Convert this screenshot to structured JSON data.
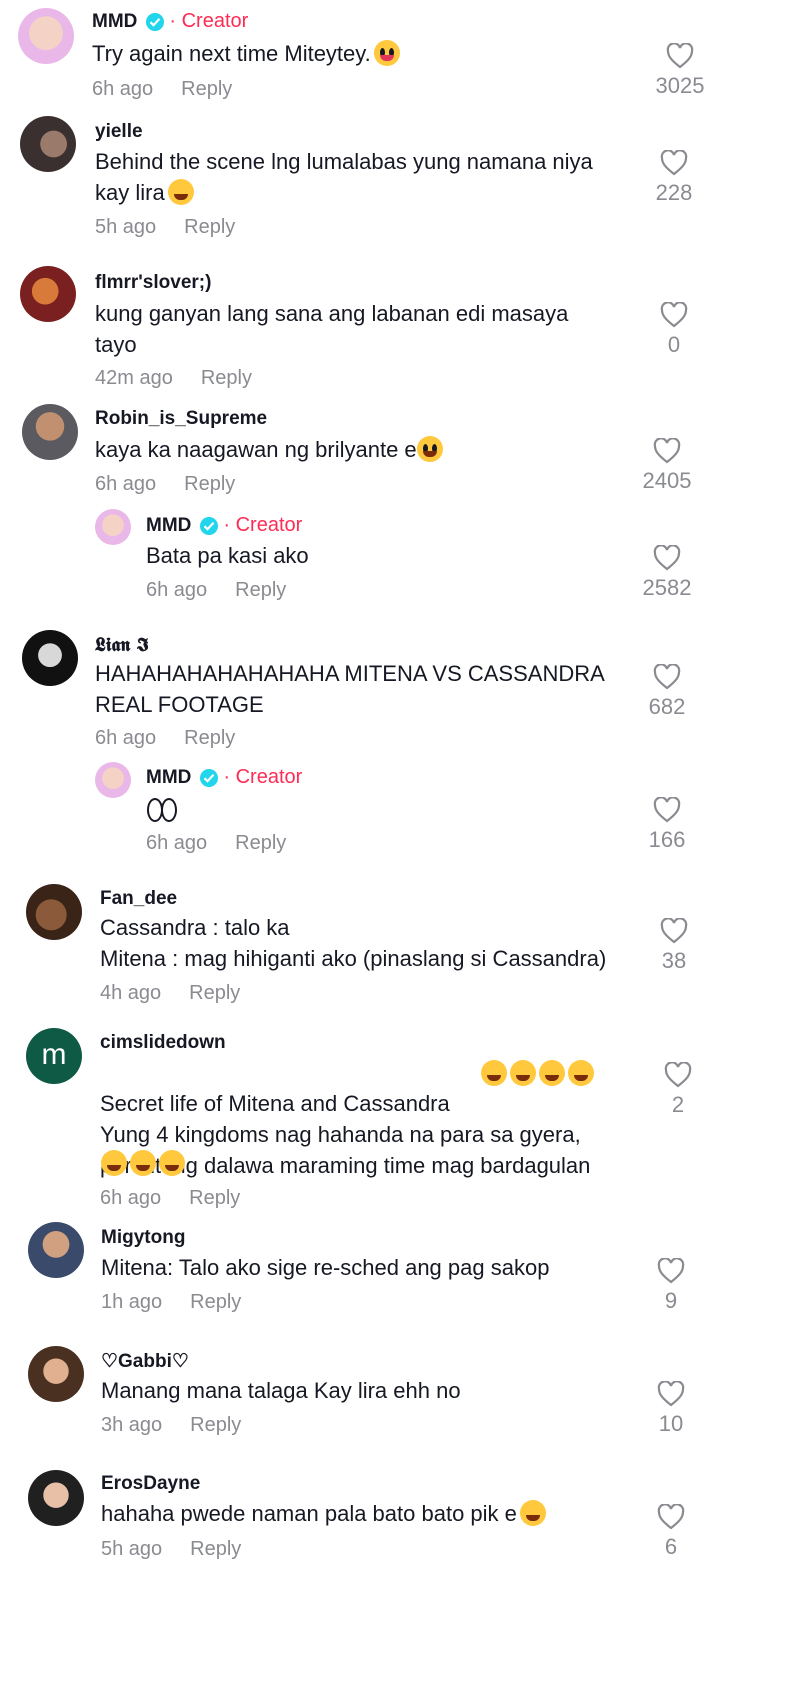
{
  "creator_label": "· Creator",
  "reply_label": "Reply",
  "comments": [
    {
      "user": "MMD",
      "creator": true,
      "text": "Try again next time Miteytey.",
      "time": "6h ago",
      "likes": "3025"
    },
    {
      "user": "yielle",
      "text": "Behind the scene lng lumalabas yung namana niya\nkay lira",
      "time": "5h ago",
      "likes": "228"
    },
    {
      "user": "flmrr'slover;)",
      "text": "kung ganyan lang sana ang labanan edi masaya\ntayo",
      "time": "42m ago",
      "likes": "0"
    },
    {
      "user": "Robin_is_Supreme",
      "text": "kaya ka naagawan ng brilyante e",
      "time": "6h ago",
      "likes": "2405"
    },
    {
      "user": "MMD",
      "creator": true,
      "reply": true,
      "text": "Bata pa kasi ako",
      "time": "6h ago",
      "likes": "2582"
    },
    {
      "user": "𝕷𝖎𝖆𝖓 𝕴",
      "text": "HAHAHAHAHAHAHAHA MITENA VS CASSANDRA\nREAL FOOTAGE",
      "time": "6h ago",
      "likes": "682"
    },
    {
      "user": "MMD",
      "creator": true,
      "reply": true,
      "text": "",
      "time": "6h ago",
      "likes": "166"
    },
    {
      "user": "Fan_dee",
      "text": "Cassandra : talo ka\nMitena : mag hihiganti ako (pinaslang si Cassandra)",
      "time": "4h ago",
      "likes": "38"
    },
    {
      "user": "cimslidedown",
      "text": "Secret life of Mitena and Cassandra\nYung 4 kingdoms nag hahanda na para sa gyera,\npero itong dalawa maraming time mag bardagulan",
      "time": "6h ago",
      "likes": "2",
      "avatar_letter": "m"
    },
    {
      "user": "Migytong",
      "text": "Mitena: Talo ako sige re-sched ang pag sakop",
      "time": "1h ago",
      "likes": "9"
    },
    {
      "user": "♡Gabbi♡",
      "text": "Manang mana talaga Kay lira ehh no",
      "time": "3h ago",
      "likes": "10"
    },
    {
      "user": "ErosDayne",
      "text": "hahaha pwede naman pala bato bato pik e",
      "time": "5h ago",
      "likes": "6"
    }
  ],
  "colors": {
    "accent": "#fe2c55",
    "verified": "#20d5ec",
    "muted": "#8a8b91"
  }
}
